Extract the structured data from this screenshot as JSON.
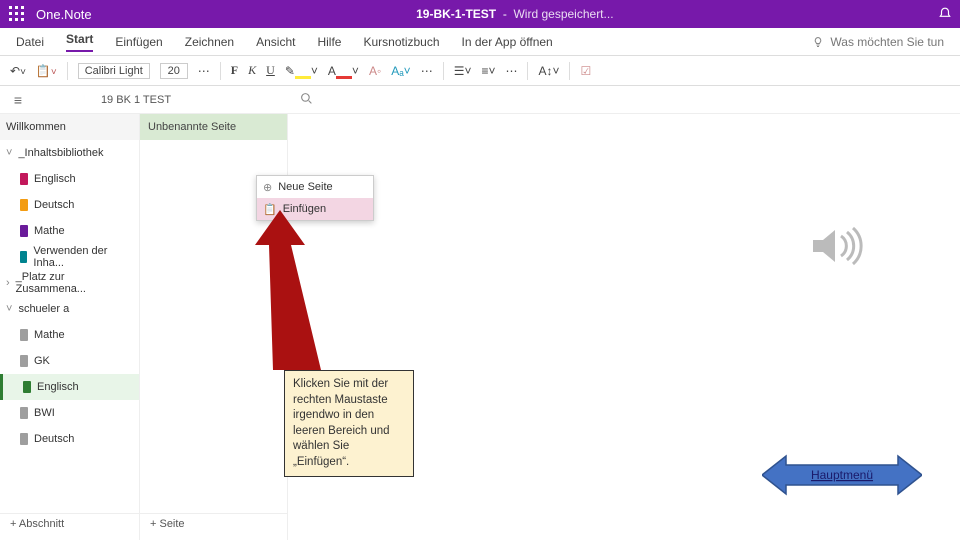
{
  "titlebar": {
    "app": "One.Note",
    "doc": "19-BK-1-TEST",
    "sep": "-",
    "status": "Wird gespeichert..."
  },
  "tabs": {
    "file": "Datei",
    "home": "Start",
    "insert": "Einfügen",
    "draw": "Zeichnen",
    "view": "Ansicht",
    "help": "Hilfe",
    "classnb": "Kursnotizbuch",
    "openapp": "In der App öffnen",
    "tell": "Was möchten Sie tun"
  },
  "ribbon": {
    "font": "Calibri Light",
    "size": "20",
    "bold": "F",
    "italic": "K",
    "underline": "U"
  },
  "subheader": {
    "title": "19 BK 1 TEST"
  },
  "sections": {
    "welcome": "Willkommen",
    "contentlib": "_Inhaltsbibliothek",
    "english": "Englisch",
    "german": "Deutsch",
    "math": "Mathe",
    "useinh": "Verwenden der Inha...",
    "platz": "_Platz zur Zusammena...",
    "student": "schueler a",
    "s_math": "Mathe",
    "s_gk": "GK",
    "s_eng": "Englisch",
    "s_bwi": "BWI",
    "s_de": "Deutsch"
  },
  "pages": {
    "untitled": "Unbenannte Seite"
  },
  "context": {
    "newpage": "Neue Seite",
    "paste": "Einfügen"
  },
  "footer": {
    "addsection": "+ Abschnitt",
    "addpage": "+ Seite"
  },
  "callout": {
    "text": "Klicken Sie mit der rechten Maustaste irgendwo in den leeren Bereich und wählen Sie „Einfügen“."
  },
  "nav": {
    "mainmenu": "Hauptmenü"
  },
  "colors": {
    "magenta": "#c2185b",
    "orange": "#f39c12",
    "purple": "#6a1b9a",
    "teal": "#00838f",
    "grey": "#9e9e9e",
    "green": "#2e7d32"
  }
}
